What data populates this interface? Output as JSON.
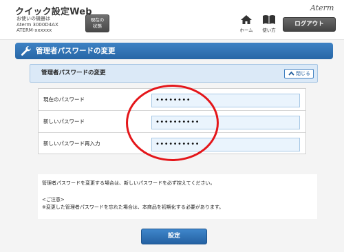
{
  "header": {
    "app_title": "クイック設定Web",
    "device_line1": "お使いの機器は",
    "device_line2": "Aterm 3000D4AX",
    "device_line3": "ATERM-xxxxxx",
    "status_line1": "現在の",
    "status_line2": "状態",
    "home_label": "ホーム",
    "help_label": "使い方",
    "logout_label": "ログアウト",
    "brand": "Aterm"
  },
  "section": {
    "title": "管理者パスワードの変更",
    "icon": "wrench-icon"
  },
  "panel": {
    "title": "管理者パスワードの変更",
    "close_label": "閉じる"
  },
  "form": {
    "rows": [
      {
        "label": "現在のパスワード",
        "value": "••••••••"
      },
      {
        "label": "新しいパスワード",
        "value": "••••••••••"
      },
      {
        "label": "新しいパスワード再入力",
        "value": "••••••••••"
      }
    ]
  },
  "note": {
    "line1": "管理者パスワードを変更する場合は、新しいパスワードを必ず控えてください。",
    "line2": "<ご注意>",
    "line3": "※変更した管理者パスワードを忘れた場合は、本商品を初期化する必要があります。"
  },
  "actions": {
    "submit_label": "設定"
  },
  "colors": {
    "accent_blue": "#2f74b8",
    "highlight_red": "#e4161a"
  }
}
